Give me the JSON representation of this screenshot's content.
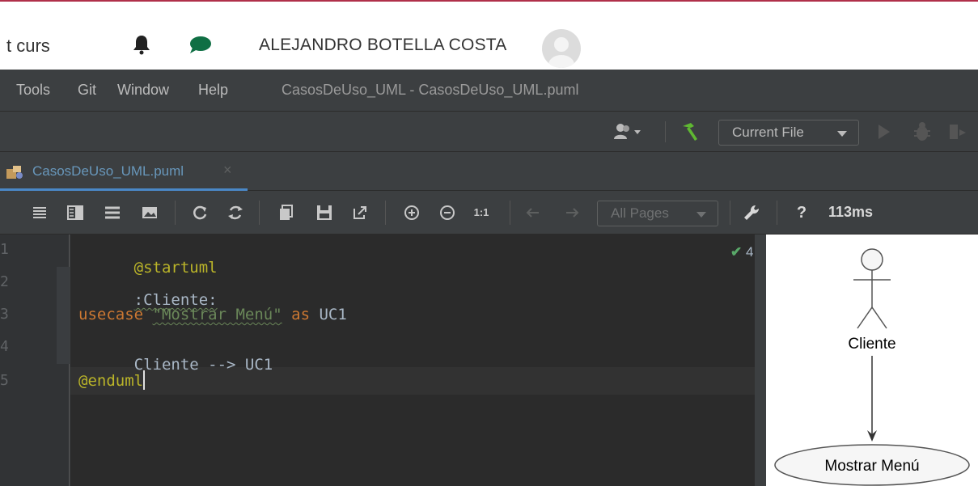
{
  "web": {
    "breadcrumb": "t curs",
    "user_name": "ALEJANDRO BOTELLA COSTA",
    "icons": [
      "bell-icon",
      "chat-icon",
      "avatar"
    ]
  },
  "ide": {
    "menu": [
      {
        "label": "Tools"
      },
      {
        "label": "Git"
      },
      {
        "label": "Window"
      },
      {
        "label": "Help"
      }
    ],
    "window_title": "CasosDeUso_UML - CasosDeUso_UML.puml",
    "run_config": "Current File",
    "tab": {
      "label": "CasosDeUso_UML.puml",
      "close": "×"
    },
    "preview_toolbar": {
      "actual_size": "1:1",
      "pages_label": "All Pages",
      "help": "?",
      "render_time": "113ms"
    },
    "editor": {
      "line_numbers": [
        "1",
        "2",
        "3",
        "4",
        "5"
      ],
      "inspection_count": "4",
      "lines": {
        "l1": "@startuml",
        "l2": ":Cliente:",
        "l3_kw": "usecase",
        "l3_str": "\"Mostrar Menú\"",
        "l3_as": "as",
        "l3_id": "UC1",
        "l4": "Cliente --> UC1",
        "l5": "@enduml"
      }
    }
  },
  "diagram": {
    "actor": "Cliente",
    "usecase": "Mostrar Menú"
  },
  "colors": {
    "ide_bg": "#3c3f41",
    "editor_bg": "#2b2b2b",
    "keyword": "#cc7832",
    "annotation": "#bbb529",
    "string": "#6a8759",
    "tab_text": "#6897bb",
    "brand_red": "#b0304a"
  }
}
